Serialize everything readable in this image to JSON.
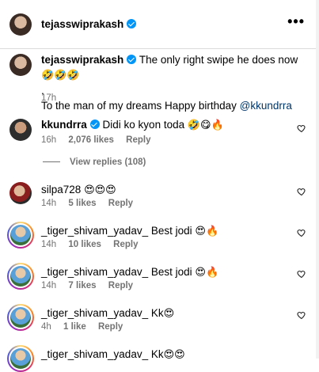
{
  "post": {
    "author": "tejasswiprakash",
    "caption_author": "tejasswiprakash",
    "caption_text": "The only right swipe he does now",
    "caption_emojis": "🤣🤣🤣",
    "caption_dot": ".",
    "caption_line2": "To the man of my dreams Happy birthday",
    "caption_mention": "@kkundrra",
    "caption_time": "17h",
    "more_label": "•••"
  },
  "comments": [
    {
      "user": "kkundrra",
      "verified": true,
      "text": "Didi ko kyon toda",
      "emojis": "🤣😋🔥",
      "time": "16h",
      "likes": "2,076 likes",
      "reply": "Reply",
      "view_replies": "View replies (108)"
    },
    {
      "user": "silpa728",
      "text": "",
      "emojis": "😍😍😍",
      "time": "14h",
      "likes": "5 likes",
      "reply": "Reply"
    },
    {
      "user": "_tiger_shivam_yadav_",
      "text": "Best jodi",
      "emojis": "😍🔥",
      "time": "14h",
      "likes": "10 likes",
      "reply": "Reply"
    },
    {
      "user": "_tiger_shivam_yadav_",
      "text": "Best jodi",
      "emojis": "😍🔥",
      "time": "14h",
      "likes": "7 likes",
      "reply": "Reply"
    },
    {
      "user": "_tiger_shivam_yadav_",
      "text": "Kk",
      "emojis": "😍",
      "time": "4h",
      "likes": "1 like",
      "reply": "Reply"
    },
    {
      "user": "_tiger_shivam_yadav_",
      "text": "Kk",
      "emojis": "😍😍",
      "time": "",
      "likes": "",
      "reply": ""
    }
  ],
  "icons": {
    "heart": "heart-outline-icon",
    "verified": "verified-badge-icon",
    "more": "more-options-icon"
  },
  "colors": {
    "verified": "#0095f6",
    "mention": "#00376b",
    "meta": "#737373"
  }
}
